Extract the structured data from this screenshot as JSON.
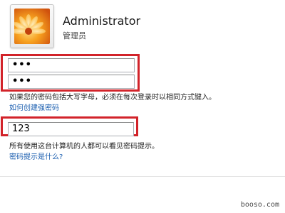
{
  "user": {
    "name": "Administrator",
    "role": "管理员",
    "avatar_icon": "orange-flower-avatar"
  },
  "password_fields": {
    "new_password_value": "•••",
    "confirm_password_value": "•••"
  },
  "case_note": "如果您的密码包括大写字母，必须在每次登录时以相同方式键入。",
  "strong_password_link": "如何创建强密码",
  "hint_field": {
    "value": "123"
  },
  "hint_note": "所有使用这台计算机的人都可以看见密码提示。",
  "hint_help_link": "密码提示是什么?",
  "watermark": "booso.com",
  "colors": {
    "highlight": "#d2232a",
    "link": "#1c5fb0"
  }
}
